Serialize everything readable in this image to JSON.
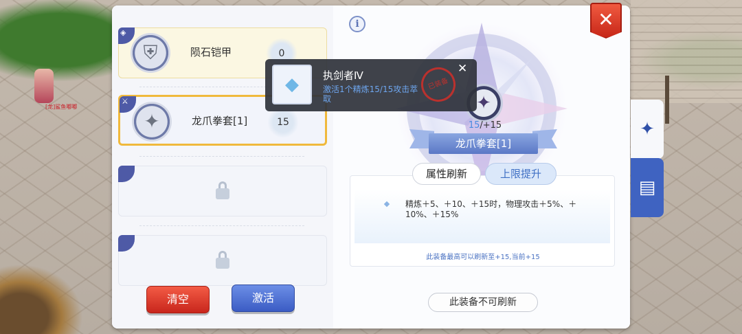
{
  "background": {
    "player_name": "[龙]鲨鱼嘟嘟",
    "decor_icon": "scene-decor"
  },
  "slots": [
    {
      "name": "陨石铠甲",
      "count": "0",
      "icon": "armor-icon",
      "state": "filled"
    },
    {
      "name": "龙爪拳套[1]",
      "count": "15",
      "icon": "claw-icon",
      "state": "selected"
    },
    {
      "name": "",
      "count": "",
      "icon": "lock-icon",
      "state": "locked"
    },
    {
      "name": "",
      "count": "",
      "icon": "lock-icon",
      "state": "locked"
    }
  ],
  "buttons": {
    "clear": "清空",
    "activate": "激活"
  },
  "tooltip": {
    "title": "执剑者Ⅳ",
    "subtitle": "激活1个精炼15/15攻击萃取",
    "stamp": "已装备",
    "close": "✕"
  },
  "equipment": {
    "refine_current": "15",
    "refine_max": "/+15",
    "name": "龙爪拳套[1]"
  },
  "tabs": {
    "refresh": "属性刷新",
    "upgrade": "上限提升"
  },
  "description": {
    "text": "精炼＋5、＋10、＋15时，物理攻击＋5%、＋10%、＋15%",
    "note": "此装备最高可以刷新至+15,当前+15"
  },
  "status_pill": "此装备不可刷新",
  "close_button": "✕",
  "side_tabs": [
    "compass-icon",
    "book-icon"
  ],
  "colors": {
    "accent_blue": "#3f63c1",
    "close_red": "#d9331f",
    "selected_border": "#f0b93c"
  }
}
